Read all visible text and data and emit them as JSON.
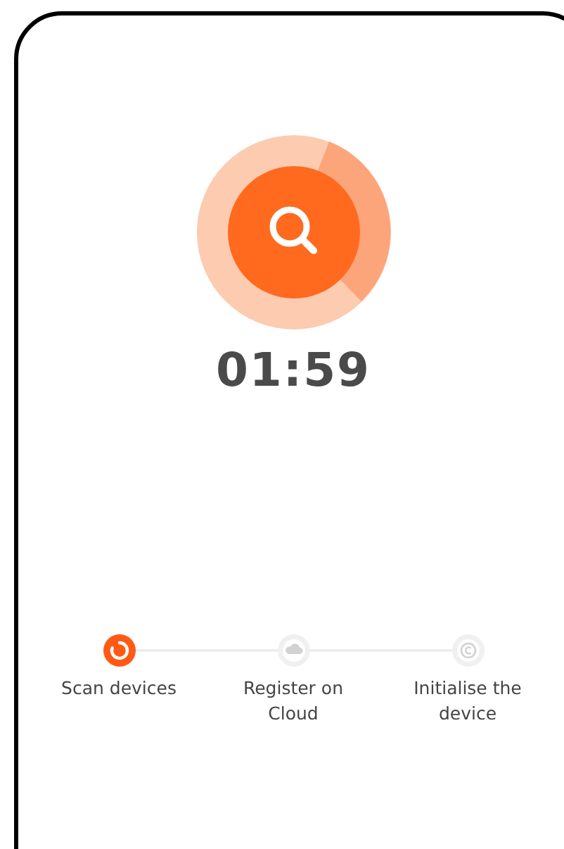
{
  "timer": "01:59",
  "steps": [
    {
      "label": "Scan devices",
      "kind": "scan",
      "selected": true
    },
    {
      "label": "Register on Cloud",
      "kind": "cloud",
      "selected": false
    },
    {
      "label": "Initialise the device",
      "kind": "init",
      "selected": false
    }
  ]
}
